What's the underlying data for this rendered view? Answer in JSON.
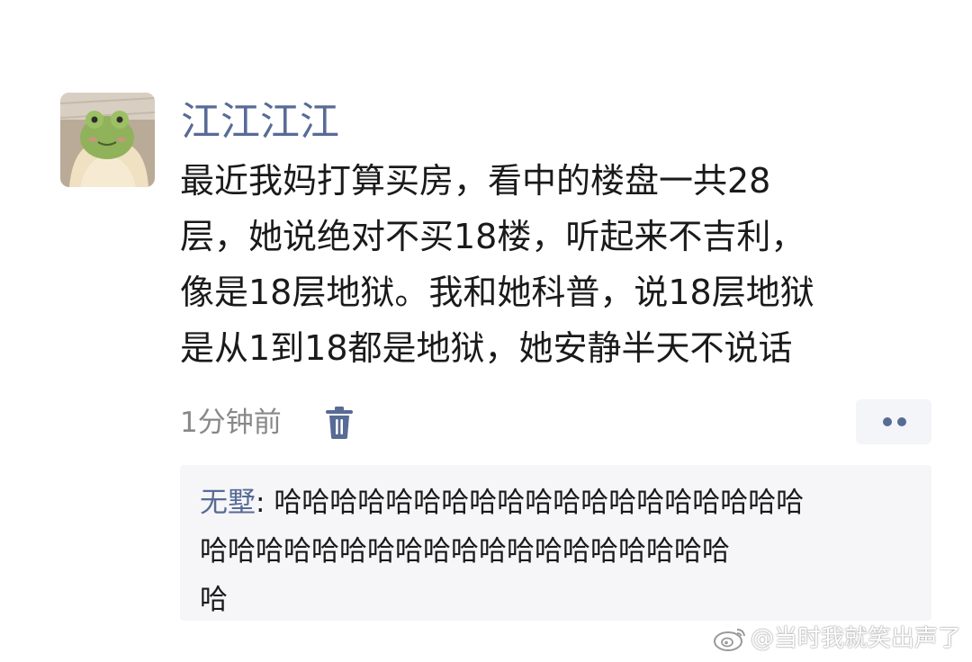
{
  "post": {
    "username": "江江江江",
    "text_lines": [
      "最近我妈打算买房，看中的楼盘一共28",
      "层，她说绝对不买18楼，听起来不吉利，",
      "像是18层地狱。我和她科普，说18层地狱",
      "是从1到18都是地狱，她安静半天不说话"
    ],
    "timestamp": "1分钟前",
    "delete_icon": "trash-icon",
    "more_icon": "more-dots-icon"
  },
  "comment": {
    "author": "无墅",
    "separator": ": ",
    "lines": [
      "哈哈哈哈哈哈哈哈哈哈哈哈哈哈哈哈哈哈哈",
      "哈哈哈哈哈哈哈哈哈哈哈哈哈哈哈哈哈哈哈",
      "哈"
    ]
  },
  "watermark": {
    "text": "@当时我就笑出声了",
    "icon": "weibo-icon"
  },
  "colors": {
    "link_blue": "#576b95",
    "comment_bg": "#f6f6f8",
    "meta_gray": "#888888"
  }
}
